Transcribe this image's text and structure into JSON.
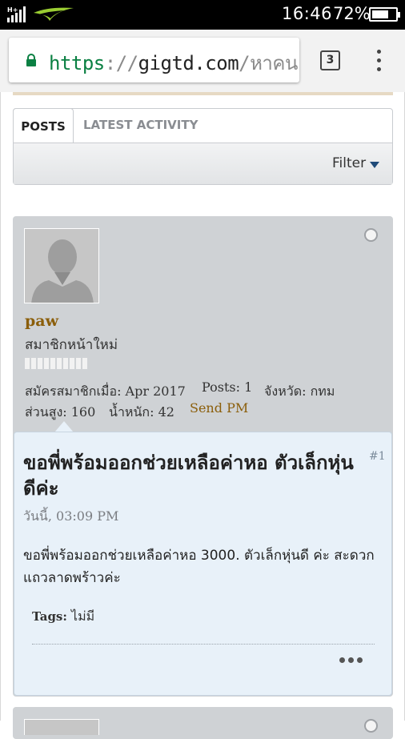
{
  "status_bar": {
    "time": "16:46",
    "battery_pct": "72%",
    "battery_level": 0.72,
    "network": "H+",
    "carrier_icon": "carrier-logo-icon"
  },
  "browser": {
    "url_scheme": "https",
    "url_separator": "://",
    "url_host": "gigtd.com",
    "url_path": "/หาคน",
    "tab_count": "3"
  },
  "tabs": {
    "posts": "POSTS",
    "latest_activity": "LATEST ACTIVITY",
    "filter": "Filter"
  },
  "post": {
    "username": "paw",
    "user_title": "สมาชิกหน้าใหม่",
    "joined": "สมัครสมาชิกเมื่อ: Apr 2017",
    "posts": "Posts: 1",
    "province": "จังหวัด: กทม",
    "height": "ส่วนสูง: 160",
    "weight": "น้ำหนัก: 42",
    "send_pm": "Send PM",
    "number": "#1",
    "title": "ขอพี่พร้อมออกช่วยเหลือค่าหอ ตัวเล็กหุ่นดีค่ะ",
    "date": "วันนี้, 03:09 PM",
    "text": "ขอพี่พร้อมออกช่วยเหลือค่าหอ 3000. ตัวเล็กหุ่นดี ค่ะ สะดวกแถวลาดพร้าวค่ะ",
    "tags_label": "Tags:",
    "tags_value": "ไม่มี"
  }
}
